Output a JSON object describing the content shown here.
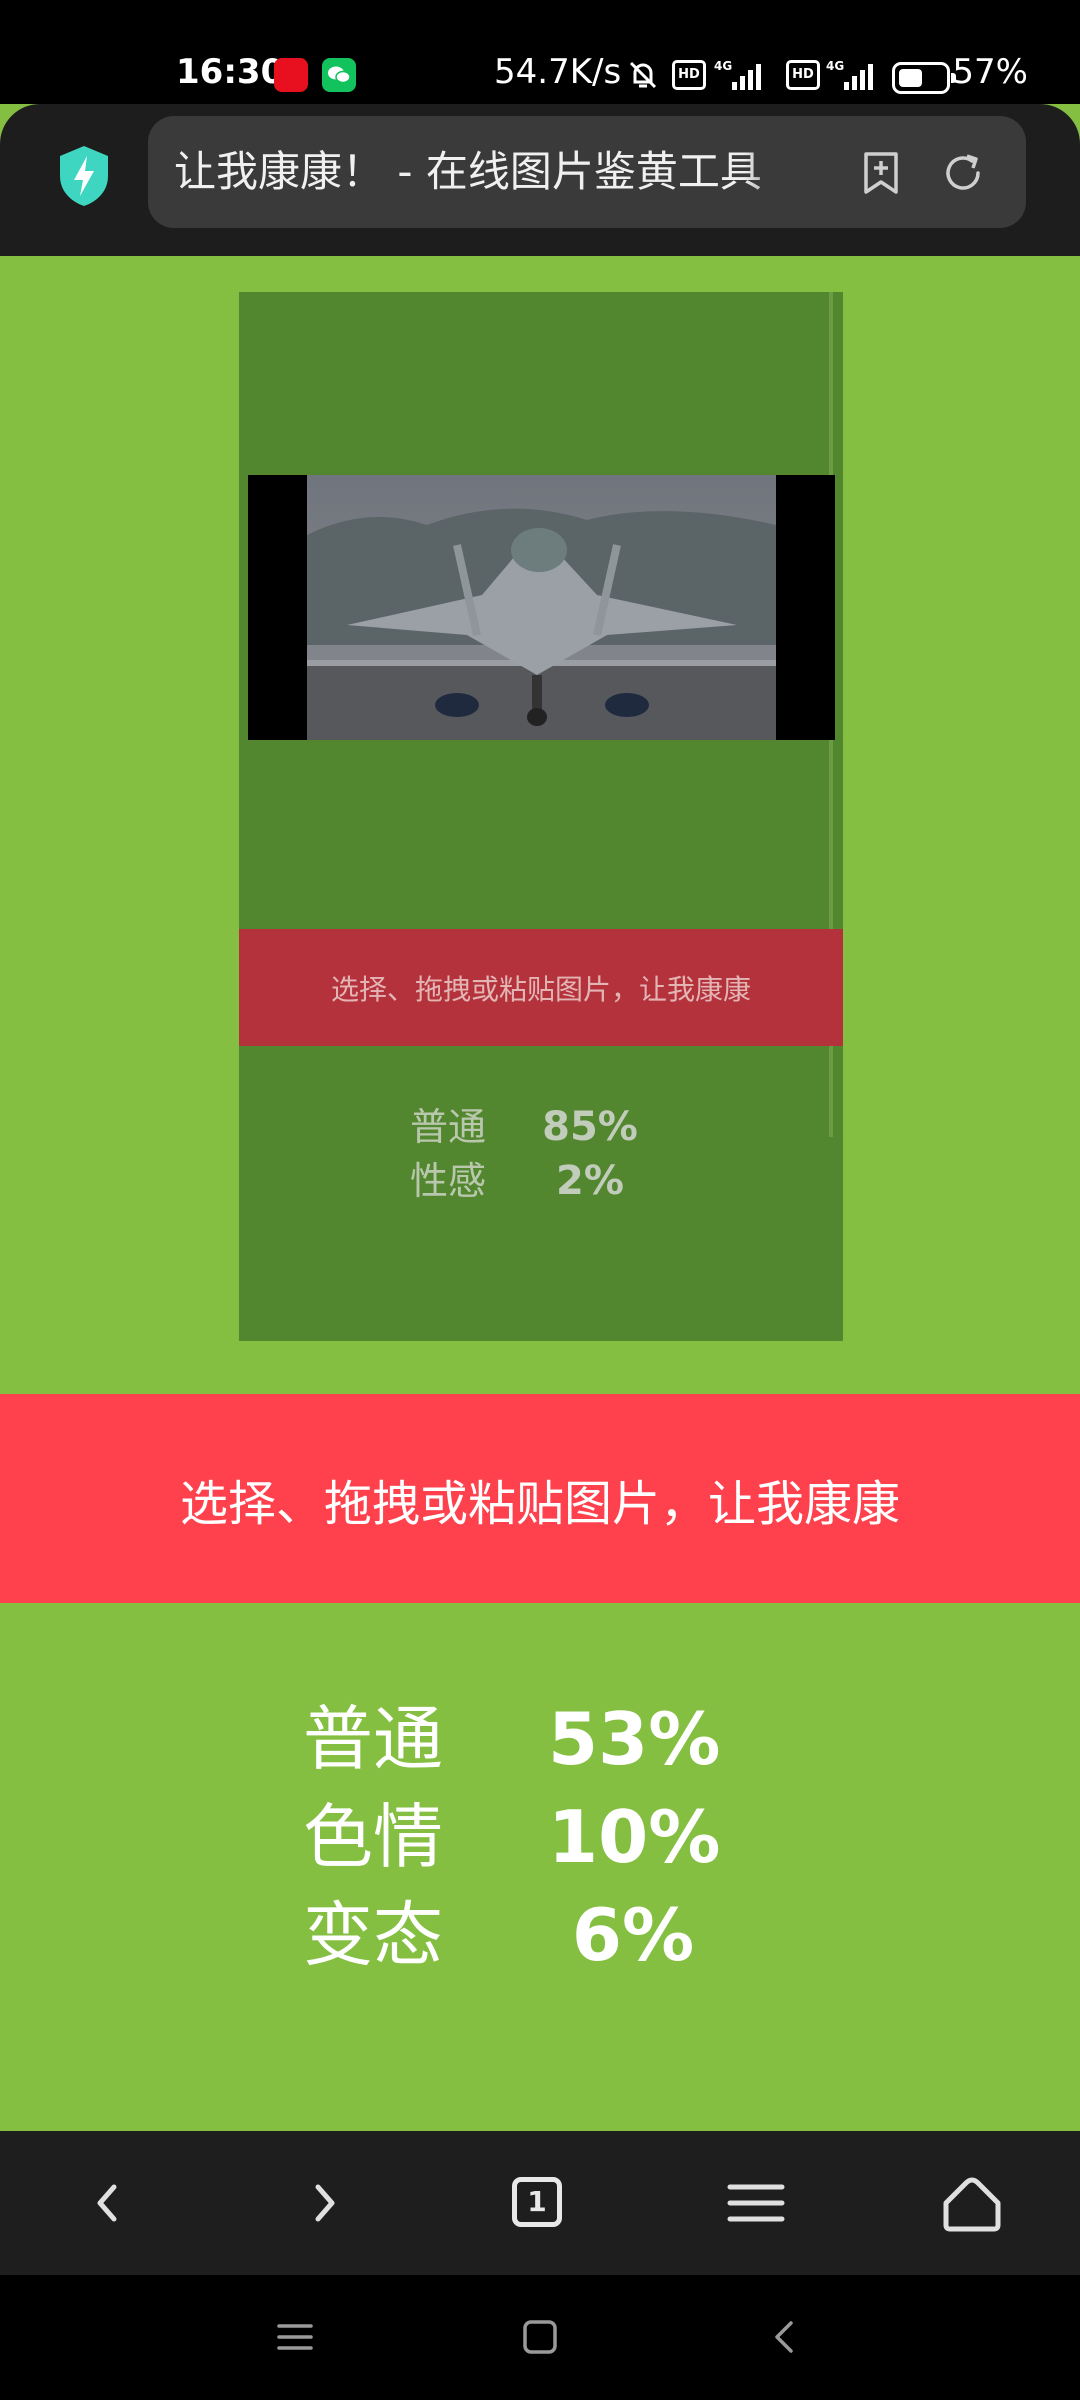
{
  "status_bar": {
    "time": "16:30",
    "net_speed": "54.7K/s",
    "hd_label": "HD",
    "network_type": "4G",
    "battery": "57%",
    "battery_level": 0.57,
    "notification_icons": [
      "youdao-app-icon",
      "wechat-icon"
    ]
  },
  "browser": {
    "page_title": "让我康康！ - 在线图片鉴黄工具",
    "icons": [
      "shield-icon",
      "add-bookmark-icon",
      "refresh-icon"
    ]
  },
  "preview": {
    "upload_label": "选择、拖拽或粘贴图片，让我康康",
    "results": [
      {
        "label": "普通",
        "value": "85%"
      },
      {
        "label": "性感",
        "value": "2%"
      }
    ]
  },
  "upload": {
    "label": "选择、拖拽或粘贴图片，让我康康"
  },
  "results": [
    {
      "label": "普通",
      "value": "53%"
    },
    {
      "label": "色情",
      "value": "10%"
    },
    {
      "label": "变态",
      "value": "6%"
    }
  ],
  "nav": {
    "tab_count": "1",
    "icons": [
      "back-icon",
      "forward-icon",
      "tabs-icon",
      "menu-icon",
      "home-icon"
    ]
  },
  "colors": {
    "page_background": "#84bf42",
    "upload_bar": "#ff414d",
    "preview_background": "#52862f"
  }
}
